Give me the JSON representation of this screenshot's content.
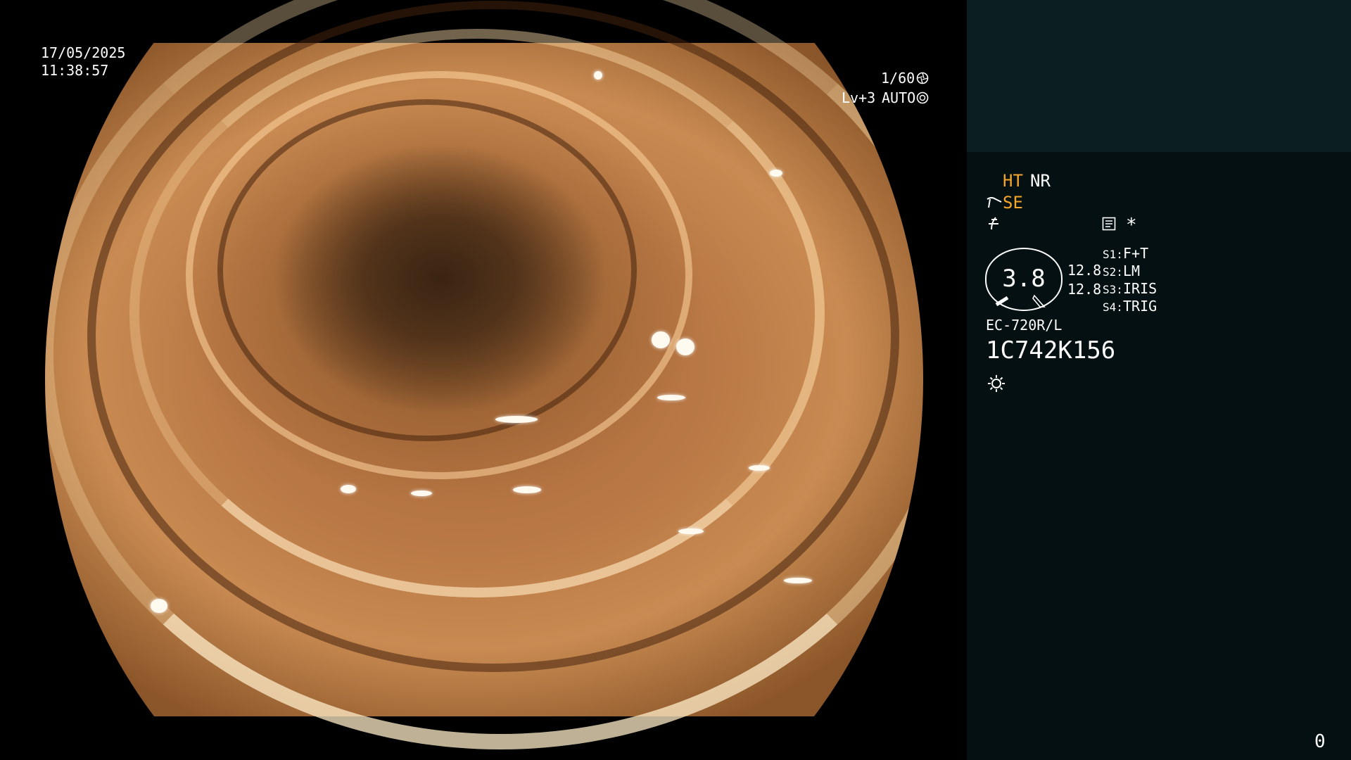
{
  "overlay": {
    "date": "17/05/2025",
    "time": "11:38:57",
    "shutter": "1/60",
    "shutter_icon": "aperture-icon",
    "level": "Lv+3",
    "mode": "AUTO",
    "mode_icon": "iris-icon"
  },
  "panel": {
    "ht": "HT",
    "nr": "NR",
    "se": "SE",
    "gauge_value": "3.8",
    "gauge_left_1": "12.8",
    "gauge_left_2": "12.8",
    "s1_key": "S1:",
    "s1_val": "F+T",
    "s2_key": "S2:",
    "s2_val": "LM",
    "s3_key": "S3:",
    "s3_val": "IRIS",
    "s4_key": "S4:",
    "s4_val": "TRIG",
    "asterisk": "*",
    "scope_model": "EC-720R/L",
    "serial": "1C742K156",
    "counter": "0"
  },
  "colors": {
    "amber": "#f4a62a",
    "panel_top": "#0b1f22",
    "panel_bottom": "#041011"
  }
}
